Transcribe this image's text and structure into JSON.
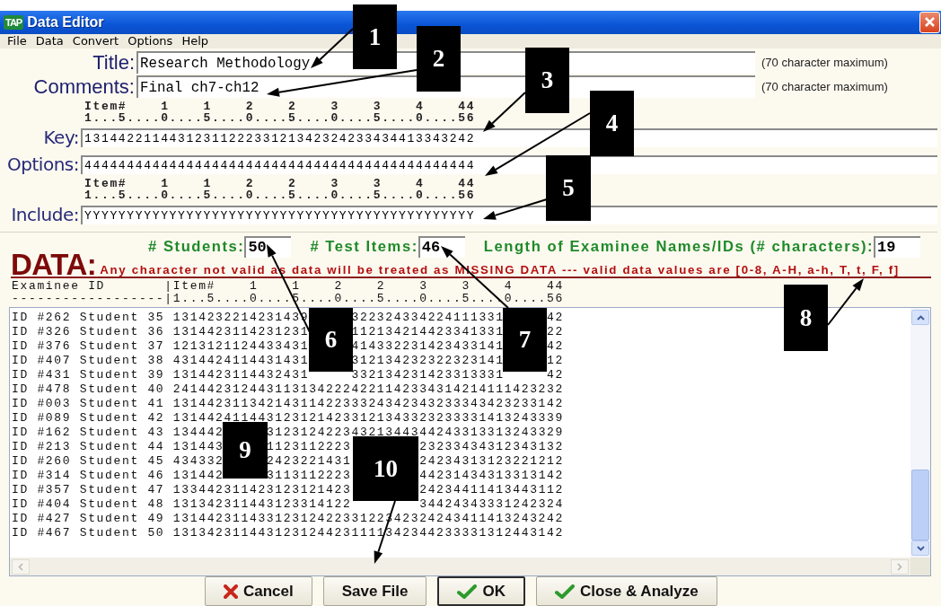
{
  "window": {
    "title": "Data Editor",
    "app_icon": "TAP"
  },
  "menu": [
    "File",
    "Data",
    "Convert",
    "Options",
    "Help"
  ],
  "header_fields": [
    {
      "label": "Title:",
      "value": "Research Methodology",
      "note": "(70 character maximum)"
    },
    {
      "label": "Comments:",
      "value": "Final ch7-ch12",
      "note": "(70 character maximum)"
    }
  ],
  "answer_rows": [
    {
      "kind": "ruler",
      "lines": [
        "Item#    1    1    2    2    3    3    4    44",
        "1...5....0....5....0....5....0....5....0....56"
      ]
    },
    {
      "kind": "field",
      "label": "Key:",
      "value": "1314422114431231122233121342324233434413343242"
    },
    {
      "kind": "field",
      "label": "Options:",
      "value": "4444444444444444444444444444444444444444444444"
    },
    {
      "kind": "ruler",
      "lines": [
        "Item#    1    1    2    2    3    3    4    44",
        "1...5....0....5....0....5....0....5....0....56"
      ]
    },
    {
      "kind": "field",
      "label": "Include:",
      "value": "YYYYYYYYYYYYYYYYYYYYYYYYYYYYYYYYYYYYYYYYYYYYYY"
    }
  ],
  "counts": [
    {
      "label": "# Students:",
      "value": "50"
    },
    {
      "label": "# Test Items:",
      "value": "46"
    },
    {
      "label": "Length of Examinee Names/IDs (# characters):",
      "value": "19"
    }
  ],
  "data": {
    "heading": "DATA:",
    "notice": "Any character not valid as data will be treated as MISSING DATA --- valid data values are [0-8, A-H, a-h, T, t, F, f]",
    "header_lines": [
      "Examinee ID       |Item#    1    1    2    2    3    3    4    44",
      "------------------|1...5....0....5....0....5....0....5....0....56"
    ],
    "rows": [
      {
        "examinee": "ID #262 Student 35",
        "responses": "1314232214231439     322324334224111331     42"
      },
      {
        "examinee": "ID #326 Student 36",
        "responses": "1314423114231231     112134214423341331     22"
      },
      {
        "examinee": "ID #376 Student 37",
        "responses": "1213121124433431     414332231423433141     42"
      },
      {
        "examinee": "ID #407 Student 38",
        "responses": "4314424114431431     312134232322323141     12"
      },
      {
        "examinee": "ID #431 Student 39",
        "responses": "1314423114432431     332134231423313331     42"
      },
      {
        "examinee": "ID #478 Student 40",
        "responses": "2414423124431131342224221142334314214111423232"
      },
      {
        "examinee": "ID #003 Student 41",
        "responses": "1314423113421431142233324342343233343423233142"
      },
      {
        "examinee": "ID #089 Student 42",
        "responses": "1314424114431231214233121343323233331413243339"
      },
      {
        "examinee": "ID #162 Student 43",
        "responses": "134442     31231242234321344344243313313243329"
      },
      {
        "examinee": "ID #213 Student 44",
        "responses": "131443     1123112223        23233434312343132"
      },
      {
        "examinee": "ID #260 Student 45",
        "responses": "434332     2423221431        24234313123221212"
      },
      {
        "examinee": "ID #314 Student 46",
        "responses": "131442     3113112223        44231434313313142"
      },
      {
        "examinee": "ID #357 Student 47",
        "responses": "133442311423123121423        24234411413443112"
      },
      {
        "examinee": "ID #404 Student 48",
        "responses": "131342311443123314122        34424343331242324"
      },
      {
        "examinee": "ID #427 Student 49",
        "responses": "1314423114331231242233122342324243411413243242"
      },
      {
        "examinee": "ID #467 Student 50",
        "responses": "1313423114431231244231111342344233331312443142"
      }
    ]
  },
  "buttons": [
    {
      "label": "Cancel",
      "kind": "cancel",
      "default": false
    },
    {
      "label": "Save File",
      "kind": "plain",
      "default": false
    },
    {
      "label": "OK",
      "kind": "confirm",
      "default": true
    },
    {
      "label": "Close & Analyze",
      "kind": "confirm",
      "default": false
    }
  ],
  "callouts": [
    {
      "label": "1"
    },
    {
      "label": "2"
    },
    {
      "label": "3"
    },
    {
      "label": "4"
    },
    {
      "label": "5"
    },
    {
      "label": "6"
    },
    {
      "label": "7"
    },
    {
      "label": "8"
    },
    {
      "label": "9"
    },
    {
      "label": "10"
    }
  ]
}
